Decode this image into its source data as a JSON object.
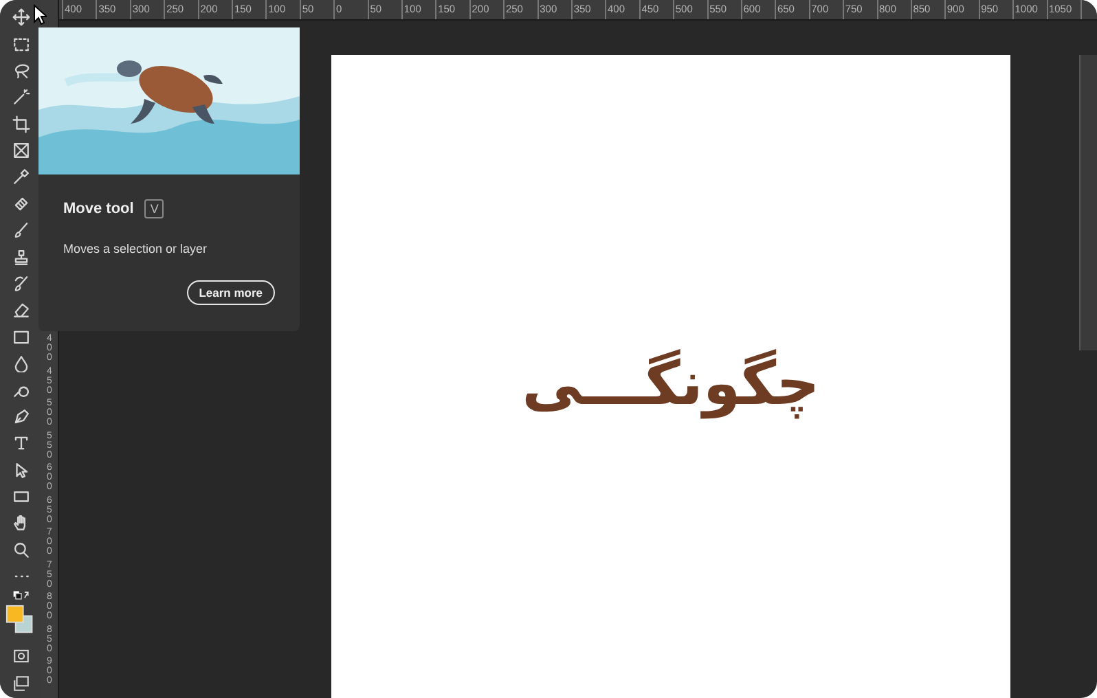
{
  "ruler_top": {
    "labels": [
      "400",
      "350",
      "300",
      "250",
      "200",
      "150",
      "100",
      "50",
      "0",
      "50",
      "100",
      "150",
      "200",
      "250",
      "300",
      "350",
      "400",
      "450",
      "500",
      "550",
      "600",
      "650",
      "700",
      "750",
      "800",
      "850",
      "900",
      "950",
      "1000",
      "1050"
    ]
  },
  "ruler_left": {
    "labels": [
      "400",
      "450",
      "500",
      "550",
      "600",
      "650",
      "700",
      "750",
      "800",
      "850",
      "900"
    ]
  },
  "tooltip": {
    "title": "Move tool",
    "shortcut": "V",
    "description": "Moves a selection or layer",
    "button": "Learn more"
  },
  "document": {
    "text": "چگونگـــی"
  }
}
